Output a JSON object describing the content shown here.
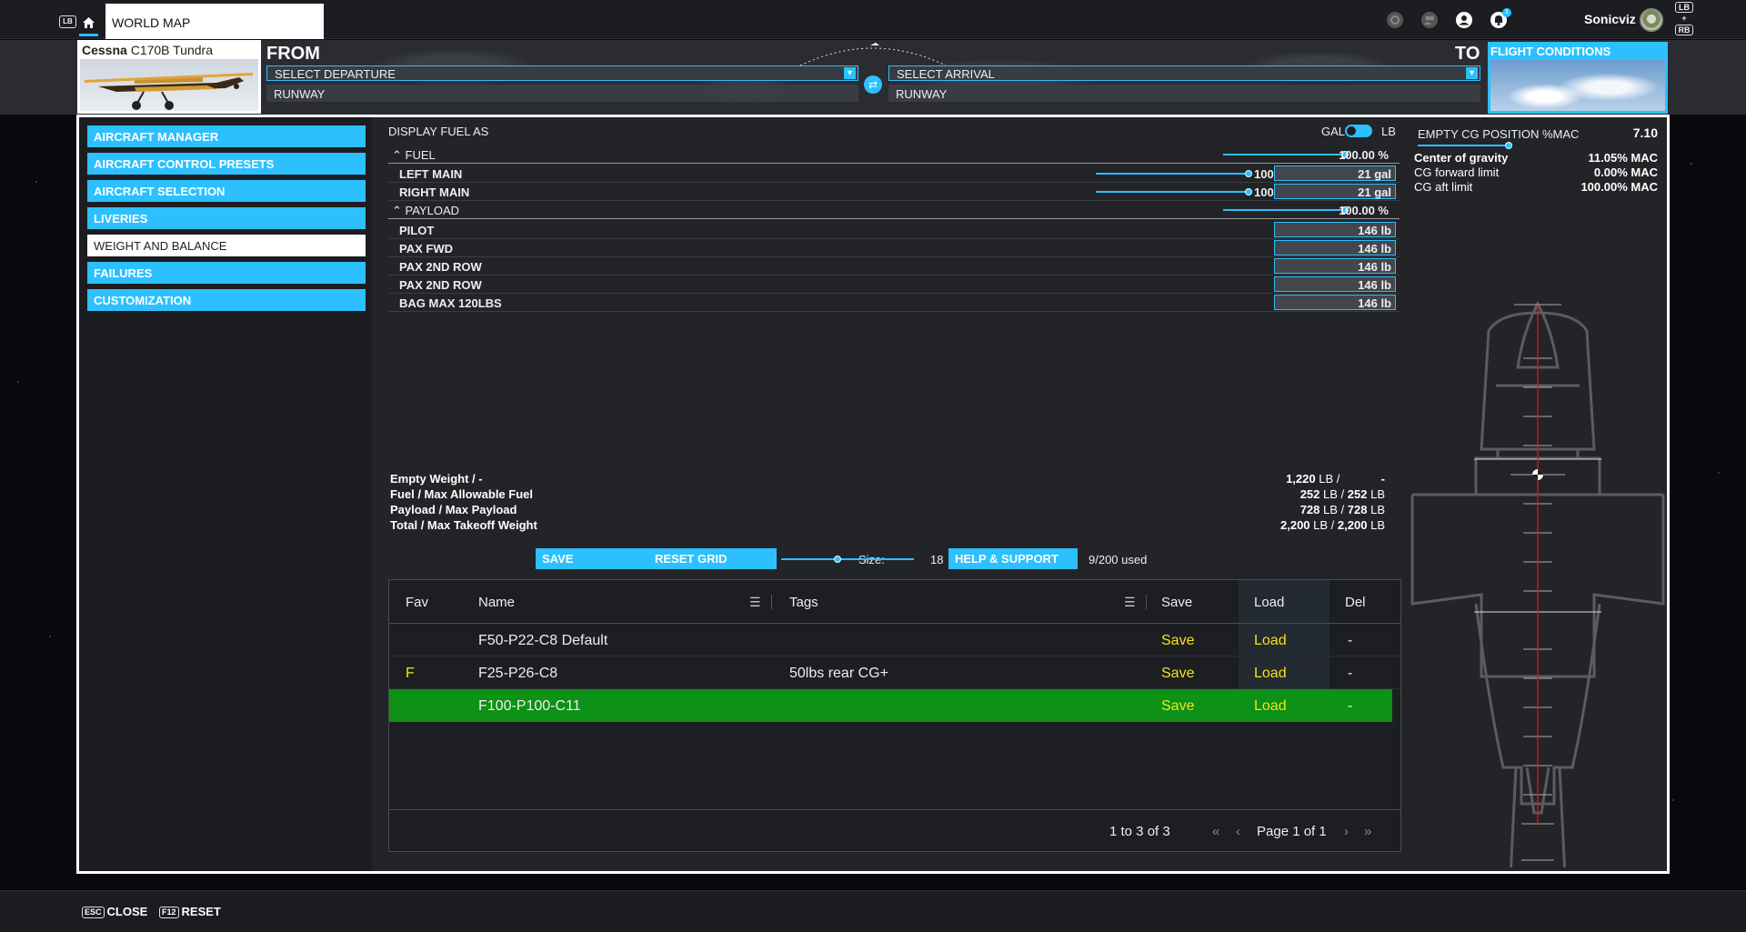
{
  "topbar": {
    "lb": "LB",
    "tab_label": "WORLD MAP",
    "username": "Sonicviz",
    "notification_count": "1",
    "right_buttons": [
      "LB",
      "+",
      "RB"
    ]
  },
  "flight": {
    "aircraft_brand": "Cessna",
    "aircraft_model": "C170B Tundra",
    "from_label": "FROM",
    "to_label": "TO",
    "departure_placeholder": "SELECT DEPARTURE",
    "arrival_placeholder": "SELECT ARRIVAL",
    "runway_left": "RUNWAY",
    "runway_right": "RUNWAY",
    "conditions_label": "FLIGHT CONDITIONS"
  },
  "sidebar": {
    "items": [
      {
        "label": "AIRCRAFT MANAGER"
      },
      {
        "label": "AIRCRAFT CONTROL PRESETS"
      },
      {
        "label": "AIRCRAFT SELECTION"
      },
      {
        "label": "LIVERIES"
      },
      {
        "label": "WEIGHT AND BALANCE"
      },
      {
        "label": "FAILURES"
      },
      {
        "label": "CUSTOMIZATION"
      }
    ],
    "active_index": 4
  },
  "fuel": {
    "display_label": "DISPLAY FUEL AS",
    "unit_a": "GAL",
    "unit_b": "LB",
    "section_label": "FUEL",
    "section_pct": "100.00 %",
    "tanks": [
      {
        "label": "LEFT MAIN",
        "slider": "100",
        "value": "21 gal"
      },
      {
        "label": "RIGHT MAIN",
        "slider": "100",
        "value": "21 gal"
      }
    ]
  },
  "payload": {
    "section_label": "PAYLOAD",
    "section_pct": "100.00 %",
    "stations": [
      {
        "label": "PILOT",
        "value": "146 lb"
      },
      {
        "label": "PAX FWD",
        "value": "146 lb"
      },
      {
        "label": "PAX 2ND ROW",
        "value": "146 lb"
      },
      {
        "label": "PAX 2ND ROW",
        "value": "146 lb"
      },
      {
        "label": "BAG MAX 120LBS",
        "value": "146 lb"
      }
    ]
  },
  "totals": [
    {
      "label": "Empty Weight / -",
      "value": "1,220",
      "unit": "LB /",
      "max": "-",
      "max_unit": ""
    },
    {
      "label": "Fuel / Max Allowable Fuel",
      "value": "252",
      "unit": "LB /",
      "max": "252",
      "max_unit": "LB"
    },
    {
      "label": "Payload / Max Payload",
      "value": "728",
      "unit": "LB /",
      "max": "728",
      "max_unit": "LB"
    },
    {
      "label": "Total / Max Takeoff Weight",
      "value": "2,200",
      "unit": "LB /",
      "max": "2,200",
      "max_unit": "LB"
    }
  ],
  "presets": {
    "save_label": "SAVE",
    "reset_label": "RESET GRID",
    "size_label": "Size:",
    "size_value": "18",
    "help_label": "HELP & SUPPORT",
    "used_label": "9/200 used",
    "columns": [
      "Fav",
      "Name",
      "Tags",
      "Save",
      "Load",
      "Del"
    ],
    "rows": [
      {
        "fav": "",
        "name": "F50-P22-C8 Default",
        "tags": "",
        "save": "Save",
        "load": "Load",
        "del": "-"
      },
      {
        "fav": "F",
        "name": "F25-P26-C8",
        "tags": "50lbs rear CG+",
        "save": "Save",
        "load": "Load",
        "del": "-"
      },
      {
        "fav": "",
        "name": "F100-P100-C11",
        "tags": "",
        "save": "Save",
        "load": "Load",
        "del": "-"
      }
    ],
    "selected_row": 2,
    "range_text": "1 to 3 of 3",
    "page_text": "Page 1 of 1"
  },
  "cg": {
    "title": "EMPTY CG POSITION %MAC",
    "value": "7.10",
    "rows": [
      {
        "label": "Center of gravity",
        "value": "11.05% MAC"
      },
      {
        "label": "CG forward limit",
        "value": "0.00% MAC"
      },
      {
        "label": "CG aft limit",
        "value": "100.00% MAC"
      }
    ]
  },
  "bottom": {
    "close_key": "ESC",
    "close_label": "CLOSE",
    "reset_key": "F12",
    "reset_label": "RESET"
  },
  "colors": {
    "accent": "#2cc0ff",
    "selected_row": "#0d9116",
    "action_text": "#f4e21b"
  }
}
